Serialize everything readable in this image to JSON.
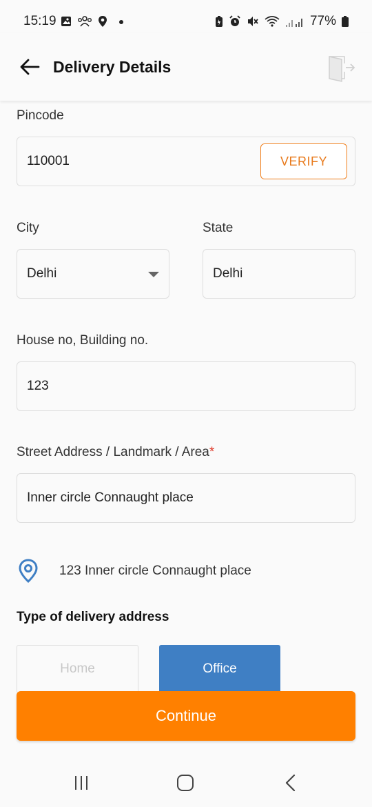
{
  "status_bar": {
    "time": "15:19",
    "battery_percent": "77%",
    "left_icons": [
      "gallery-icon",
      "people-icon",
      "location-pin-icon",
      "dot-icon"
    ],
    "right_icons": [
      "battery-saver-icon",
      "alarm-icon",
      "mute-icon",
      "wifi-icon",
      "signal-icon",
      "battery-icon"
    ]
  },
  "header": {
    "title": "Delivery Details",
    "back_icon": "arrow-left-icon",
    "exit_icon": "exit-door-icon"
  },
  "form": {
    "pincode": {
      "label": "Pincode",
      "value": "110001",
      "verify_label": "VERIFY"
    },
    "city": {
      "label": "City",
      "value": "Delhi"
    },
    "state": {
      "label": "State",
      "value": "Delhi"
    },
    "house": {
      "label": "House no, Building no.",
      "value": "123"
    },
    "street": {
      "label": "Street Address / Landmark / Area",
      "required_mark": "*",
      "value": "Inner circle Connaught place"
    }
  },
  "location_preview": {
    "icon": "map-pin-icon",
    "text": "123 Inner circle Connaught place"
  },
  "address_type": {
    "title": "Type of delivery address",
    "options": [
      "Home",
      "Office"
    ],
    "selected": "Office"
  },
  "continue_label": "Continue",
  "colors": {
    "accent_orange": "#ff8000",
    "selected_blue": "#3f7fc4",
    "verify_border": "#f07f1c",
    "required_red": "#e03a2a"
  },
  "nav_bar": {
    "icons": [
      "recents-icon",
      "home-icon",
      "back-icon"
    ]
  }
}
